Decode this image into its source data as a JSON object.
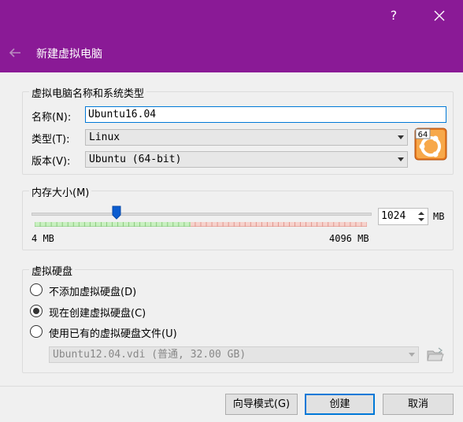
{
  "titlebar": {
    "help_label": "?",
    "title": "新建虚拟电脑",
    "background_color": "#8a1a96"
  },
  "name_group": {
    "title": "虚拟电脑名称和系统类型",
    "name_label": "名称(N):",
    "name_value": "Ubuntu16.04",
    "type_label": "类型(T):",
    "type_value": "Linux",
    "version_label": "版本(V):",
    "version_value": "Ubuntu (64-bit)",
    "os_icon": "ubuntu-64-os-icon",
    "os_icon_badge": "64"
  },
  "memory_group": {
    "title": "内存大小(M)",
    "slider_value_fraction": 0.25,
    "min_label": "4 MB",
    "max_label": "4096 MB",
    "value": "1024",
    "unit": "MB"
  },
  "disk_group": {
    "title": "虚拟硬盘",
    "options": [
      {
        "label": "不添加虚拟硬盘(D)",
        "checked": false
      },
      {
        "label": "现在创建虚拟硬盘(C)",
        "checked": true
      },
      {
        "label": "使用已有的虚拟硬盘文件(U)",
        "checked": false
      }
    ],
    "existing_file_value": "Ubuntu12.04.vdi (普通, 32.00 GB)"
  },
  "footer": {
    "guided_mode_label": "向导模式(G)",
    "create_label": "创建",
    "cancel_label": "取消"
  }
}
